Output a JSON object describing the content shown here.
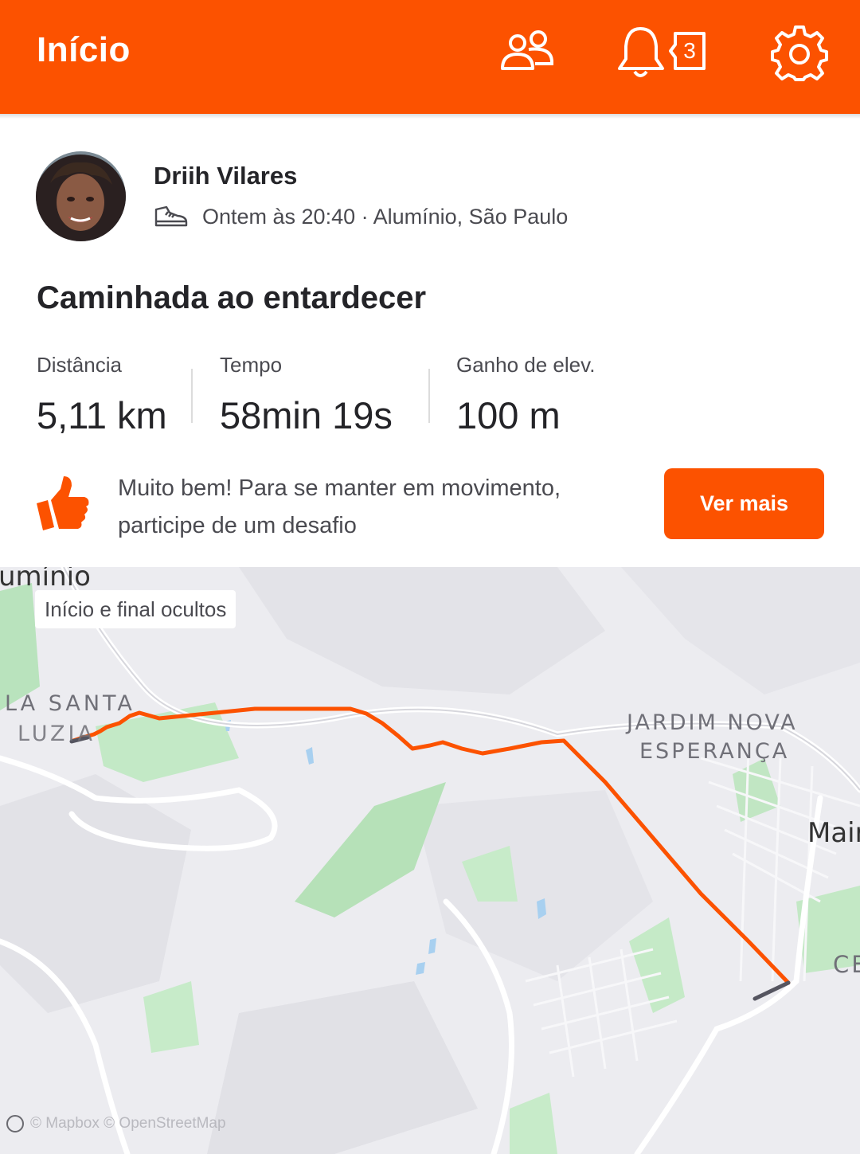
{
  "header": {
    "title": "Início",
    "notification_count": "3",
    "brand_color": "#fc5200"
  },
  "activity": {
    "athlete_name": "Driih Vilares",
    "activity_icon": "walking-shoe-icon",
    "meta": "Ontem às 20:40 · Alumínio, São Paulo",
    "title": "Caminhada ao entardecer",
    "stats": [
      {
        "label": "Distância",
        "value": "5,11 km"
      },
      {
        "label": "Tempo",
        "value": "58min 19s"
      },
      {
        "label": "Ganho de elev.",
        "value": "100 m"
      }
    ]
  },
  "promo": {
    "icon": "thumbs-up-icon",
    "text": "Muito bem! Para se manter em movimento, participe de um desafio",
    "button_label": "Ver mais"
  },
  "map": {
    "hidden_label": "Início e final ocultos",
    "place_labels": {
      "aluminio": "umínio",
      "santa_luzia_1": "LA SANTA",
      "santa_luzia_2": "LUZIA",
      "jardim_1": "JARDIM NOVA",
      "jardim_2": "ESPERANÇA",
      "mairinque": "Mair",
      "ce": "CE"
    },
    "attribution": "© Mapbox © OpenStreetMap",
    "route_color": "#fc5200"
  }
}
